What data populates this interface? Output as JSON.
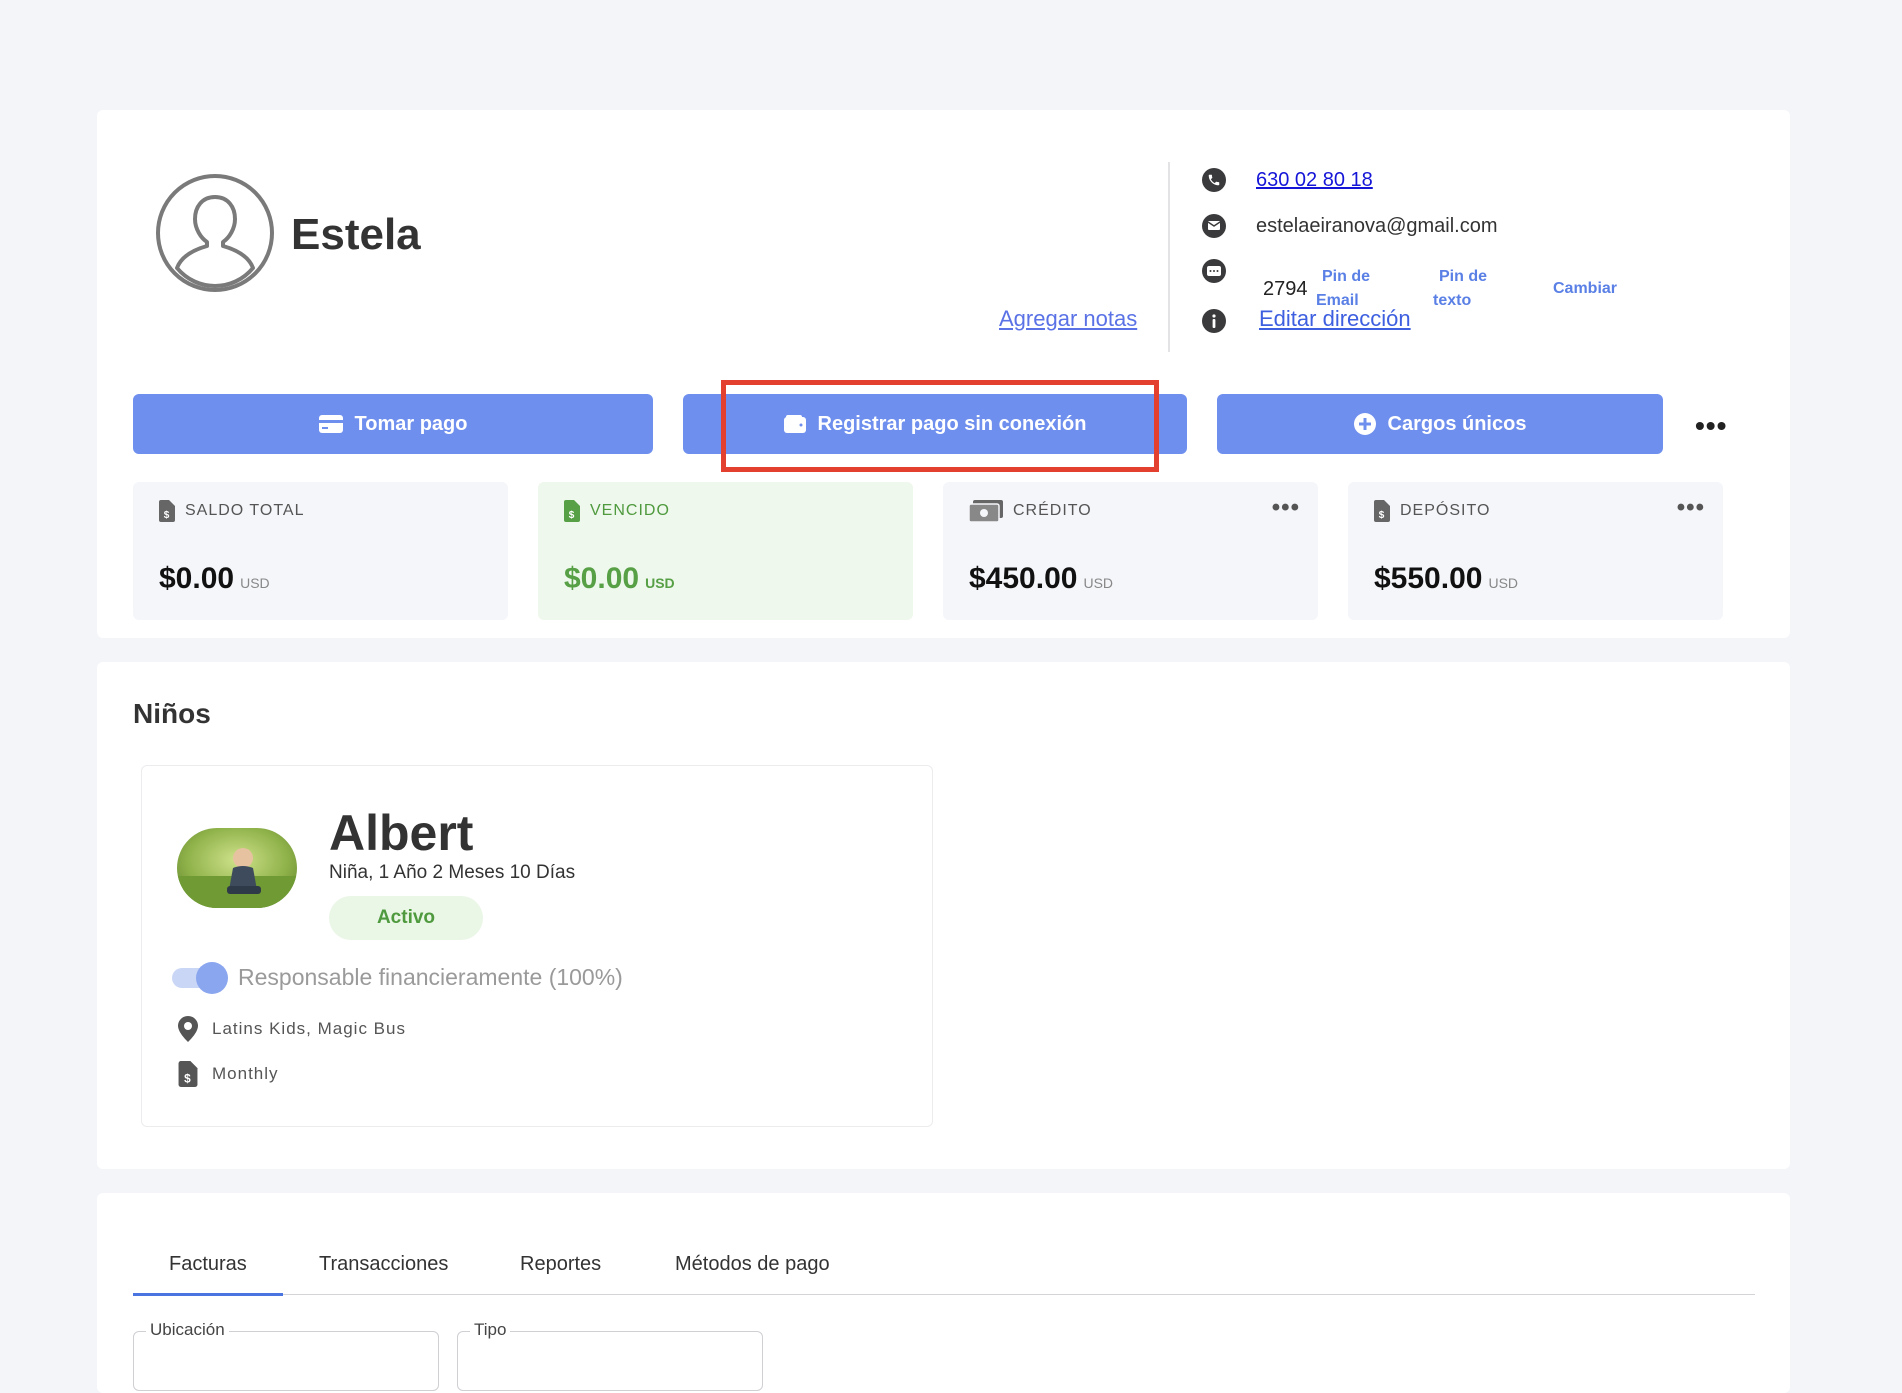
{
  "parent": {
    "name": "Estela",
    "add_notes": "Agregar notas"
  },
  "contact": {
    "phone": "630 02 80 18",
    "email": "estelaeiranova@gmail.com",
    "pin": "2794",
    "pin_email_line1": "Pin de",
    "pin_email_line2": "Email",
    "pin_text_line1": "Pin de",
    "pin_text_line2": "texto",
    "change": "Cambiar",
    "edit_address": "Editar dirección"
  },
  "actions": {
    "take_payment": "Tomar pago",
    "offline_payment": "Registrar pago sin conexión",
    "one_time_charges": "Cargos únicos",
    "more": "•••"
  },
  "stats": [
    {
      "label": "SALDO TOTAL",
      "value": "$0.00",
      "currency": "USD",
      "icon": "invoice-dollar-icon"
    },
    {
      "label": "VENCIDO",
      "value": "$0.00",
      "currency": "USD",
      "icon": "invoice-dollar-icon"
    },
    {
      "label": "CRÉDITO",
      "value": "$450.00",
      "currency": "USD",
      "icon": "money-bill-icon",
      "more": "•••"
    },
    {
      "label": "DEPÓSITO",
      "value": "$550.00",
      "currency": "USD",
      "icon": "invoice-dollar-icon",
      "more": "•••"
    }
  ],
  "children": {
    "title": "Niños",
    "items": [
      {
        "name": "Albert",
        "details": "Niña, 1 Año 2 Meses 10 Días",
        "status": "Activo",
        "financial_label": "Responsable financieramente (100%)",
        "financial_on": true,
        "location": "Latins Kids, Magic Bus",
        "plan": "Monthly"
      }
    ]
  },
  "tabs": {
    "items": [
      "Facturas",
      "Transacciones",
      "Reportes",
      "Métodos de pago"
    ],
    "active": "Facturas"
  },
  "filters": {
    "location_label": "Ubicación",
    "type_label": "Tipo"
  },
  "colors": {
    "primary_button": "#6f8fee",
    "highlight": "#e3402f",
    "success": "#4f9a3e"
  }
}
